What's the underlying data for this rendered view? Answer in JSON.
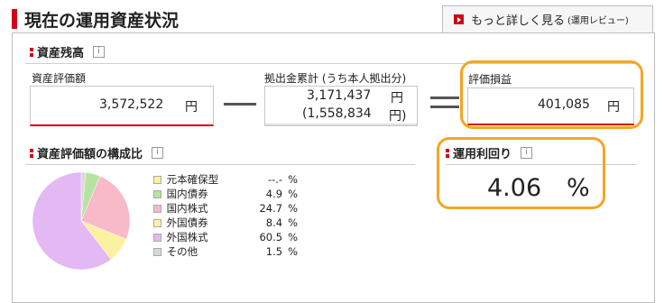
{
  "header": {
    "title": "現在の運用資産状況",
    "more_button": "もっと詳しく見る",
    "more_button_sub": "(運用レビュー)"
  },
  "balance": {
    "section_title": "資産残高",
    "info_icon": "i",
    "asset_value_label": "資産評価額",
    "asset_value": "3,572,522",
    "contribution_label": "拠出金累計 (うち本人拠出分)",
    "contribution_total": "3,171,437",
    "contribution_personal": "(1,558,834",
    "gain_label": "評価損益",
    "gain_value": "401,085",
    "yen": "円",
    "yen_close": "円)",
    "minus_sign": "—",
    "equals_sign": "="
  },
  "composition": {
    "section_title": "資産評価額の構成比",
    "info_icon": "i",
    "items": [
      {
        "label": "元本確保型",
        "value": "--.-",
        "unit": "%",
        "color": "#f9f29a",
        "pct": 0
      },
      {
        "label": "国内債券",
        "value": "4.9",
        "unit": "%",
        "color": "#b7e3a1",
        "pct": 4.9
      },
      {
        "label": "国内株式",
        "value": "24.7",
        "unit": "%",
        "color": "#f8b9c8",
        "pct": 24.7
      },
      {
        "label": "外国債券",
        "value": "8.4",
        "unit": "%",
        "color": "#fbf1a0",
        "pct": 8.4
      },
      {
        "label": "外国株式",
        "value": "60.5",
        "unit": "%",
        "color": "#e3b8f3",
        "pct": 60.5
      },
      {
        "label": "その他",
        "value": "1.5",
        "unit": "%",
        "color": "#d8d8d8",
        "pct": 1.5
      }
    ]
  },
  "yield": {
    "section_title": "運用利回り",
    "info_icon": "i",
    "value": "4.06",
    "unit": "%"
  }
}
